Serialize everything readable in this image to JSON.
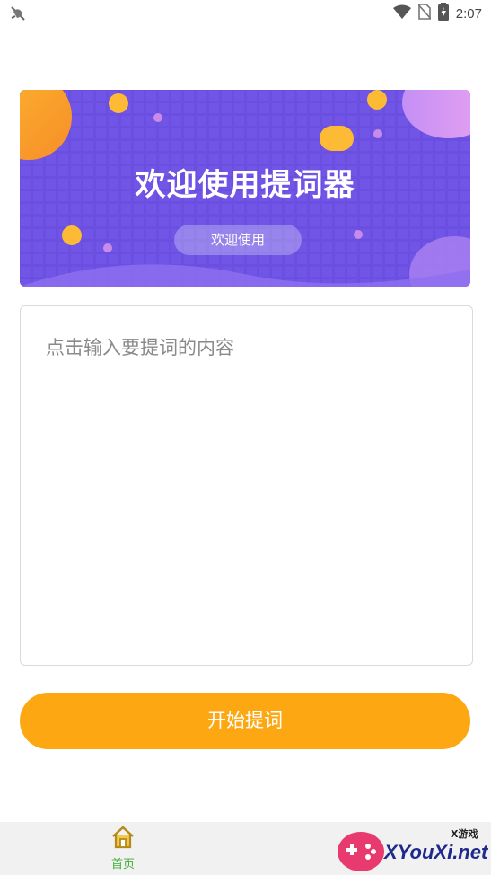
{
  "status_bar": {
    "time": "2:07",
    "icons": [
      "bug-icon",
      "wifi-icon",
      "no-sim-icon",
      "battery-charging-icon"
    ]
  },
  "banner": {
    "title": "欢迎使用提词器",
    "pill_label": "欢迎使用",
    "colors": {
      "background": "#6a4fe0",
      "accent": "#fdb52c",
      "bubble": "#b28bf2"
    }
  },
  "input": {
    "placeholder": "点击输入要提词的内容",
    "value": ""
  },
  "start_button": {
    "label": "开始提词",
    "color": "#fda713"
  },
  "tab_bar": {
    "items": [
      {
        "label": "首页",
        "icon": "home-icon",
        "active": true,
        "color": "#3fae3a"
      }
    ]
  },
  "watermark": {
    "brand": "XYouXi.net",
    "tag": "X游戏"
  }
}
